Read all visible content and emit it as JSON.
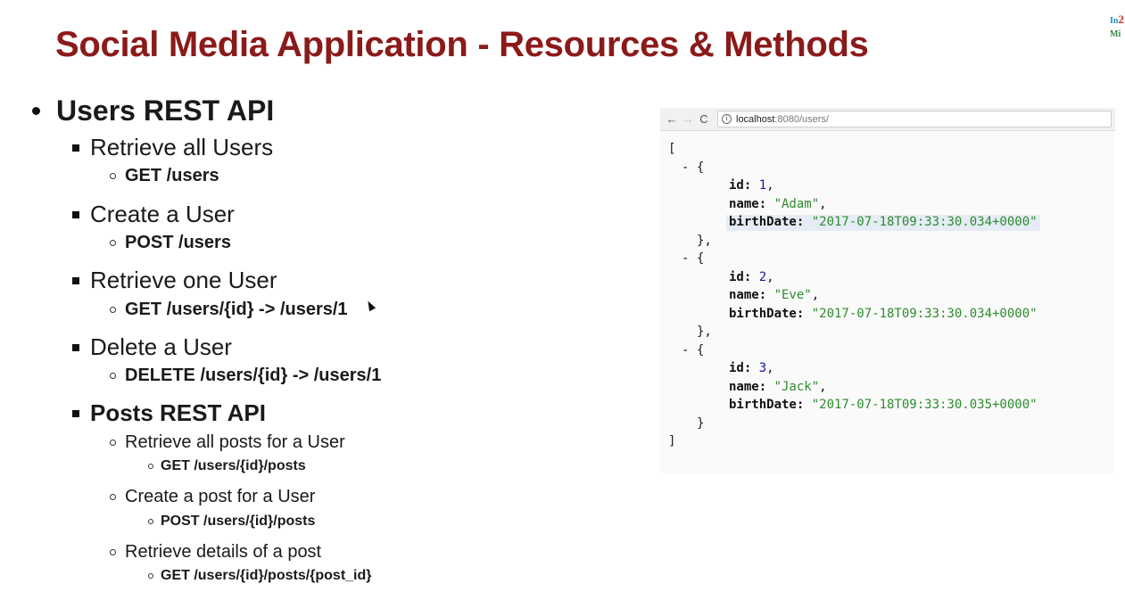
{
  "logo": {
    "line1": "In",
    "line1_accent": "2",
    "line2": "Mi"
  },
  "title": "Social Media Application - Resources & Methods",
  "outline": {
    "users_api": "Users REST API",
    "retrieve_all": "Retrieve all Users",
    "retrieve_all_method": "GET /users",
    "create": "Create a User",
    "create_method": "POST /users",
    "retrieve_one": "Retrieve one User",
    "retrieve_one_method": "GET /users/{id} -> /users/1",
    "delete": "Delete a User",
    "delete_method": "DELETE /users/{id} -> /users/1",
    "posts_api": "Posts REST API",
    "posts_retrieve_all": "Retrieve all posts for a User",
    "posts_retrieve_all_method": "GET /users/{id}/posts",
    "posts_create": "Create a post for a User",
    "posts_create_method": "POST /users/{id}/posts",
    "posts_details": "Retrieve details of a post",
    "posts_details_method": "GET /users/{id}/posts/{post_id}"
  },
  "browser": {
    "back": "←",
    "forward": "→",
    "reload": "C",
    "info": "i",
    "url_host": "localhost",
    "url_path": ":8080/users/",
    "json": {
      "open": "[",
      "close": "]",
      "users": [
        {
          "id": "1",
          "name": "\"Adam\"",
          "birthDate": "\"2017-07-18T09:33:30.034+0000\""
        },
        {
          "id": "2",
          "name": "\"Eve\"",
          "birthDate": "\"2017-07-18T09:33:30.034+0000\""
        },
        {
          "id": "3",
          "name": "\"Jack\"",
          "birthDate": "\"2017-07-18T09:33:30.035+0000\""
        }
      ]
    }
  }
}
